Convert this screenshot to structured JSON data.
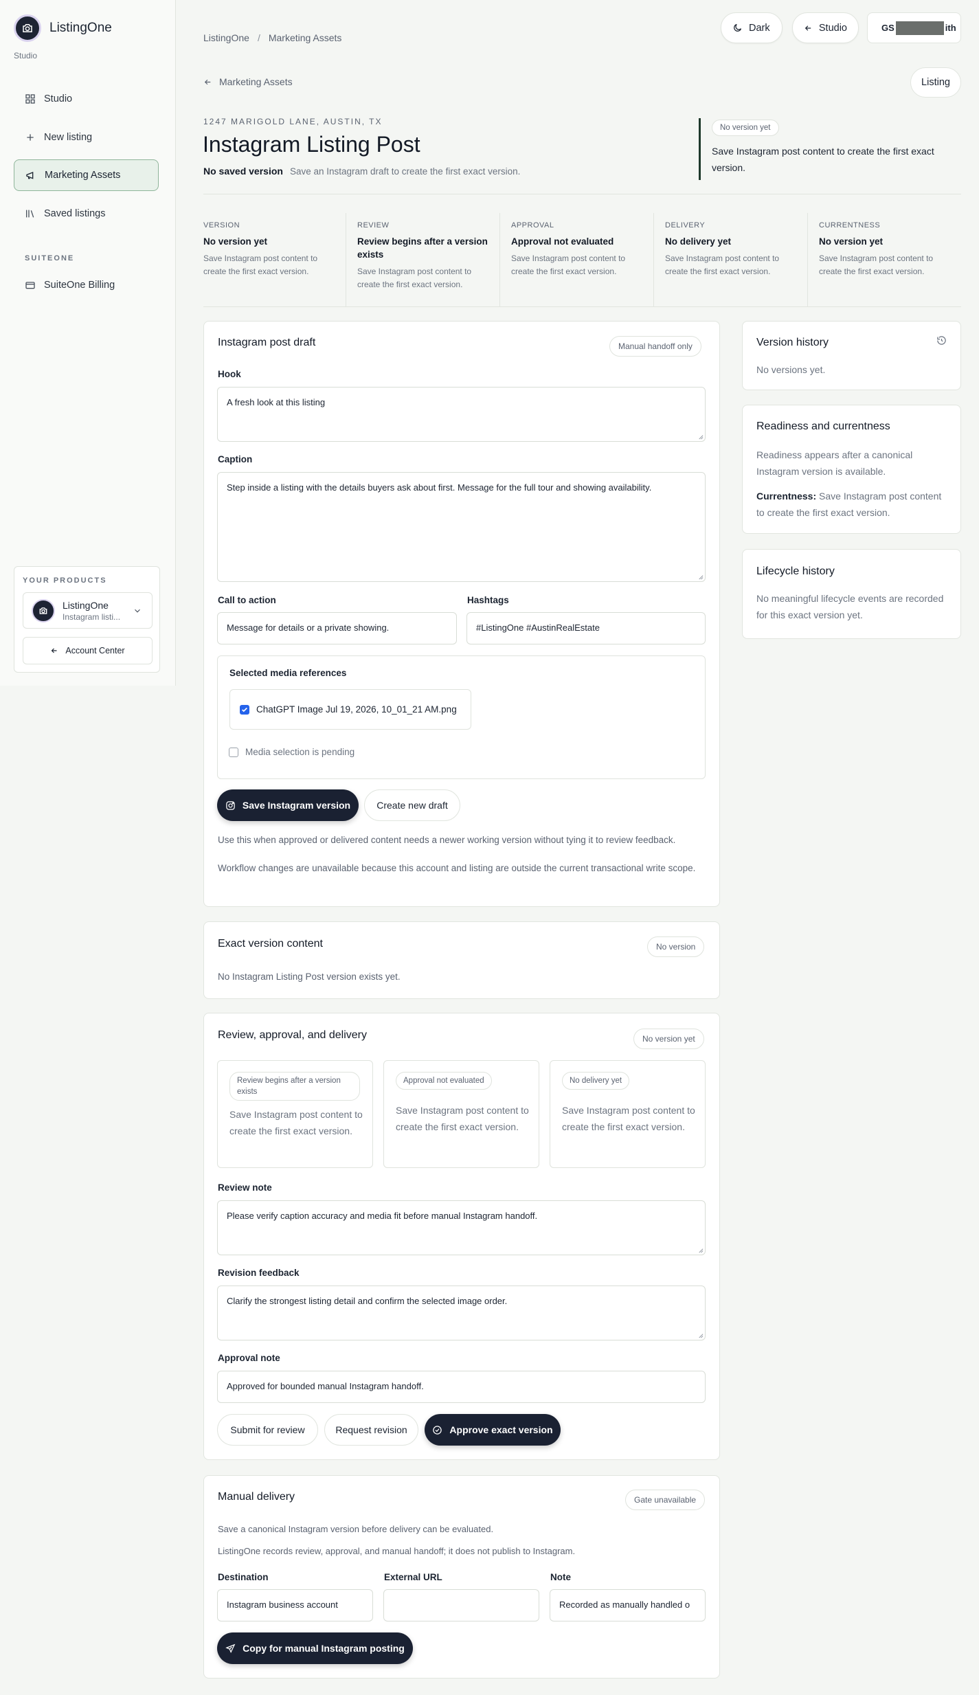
{
  "app": {
    "name": "ListingOne",
    "subtitle": "Studio"
  },
  "sidebar": {
    "items": [
      {
        "label": "Studio",
        "icon": "grid-icon"
      },
      {
        "label": "New listing",
        "icon": "plus-icon"
      },
      {
        "label": "Marketing Assets",
        "icon": "megaphone-icon"
      },
      {
        "label": "Saved listings",
        "icon": "library-icon"
      }
    ],
    "section_label": "SUITEONE",
    "billing_label": "SuiteOne Billing",
    "products": {
      "heading": "YOUR PRODUCTS",
      "selected_name": "ListingOne",
      "selected_desc": "Instagram listi...",
      "account_center": "Account Center"
    }
  },
  "topbar": {
    "breadcrumb": [
      "ListingOne",
      "Marketing Assets"
    ],
    "dark_label": "Dark",
    "studio_label": "Studio",
    "user_prefix": "GS",
    "user_suffix": "ith"
  },
  "header": {
    "back_label": "Marketing Assets",
    "listing_pill": "Listing",
    "address": "1247 MARIGOLD LANE, AUSTIN, TX",
    "title": "Instagram Listing Post",
    "status_bold": "No saved version",
    "status_hint": "Save an Instagram draft to create the first exact version.",
    "callout_tag": "No version yet",
    "callout_text": "Save Instagram post content to create the first exact version."
  },
  "summary": [
    {
      "key": "VERSION",
      "value": "No version yet",
      "desc": "Save Instagram post content to create the first exact version."
    },
    {
      "key": "REVIEW",
      "value": "Review begins after a version exists",
      "desc": "Save Instagram post content to create the first exact version."
    },
    {
      "key": "APPROVAL",
      "value": "Approval not evaluated",
      "desc": "Save Instagram post content to create the first exact version."
    },
    {
      "key": "DELIVERY",
      "value": "No delivery yet",
      "desc": "Save Instagram post content to create the first exact version."
    },
    {
      "key": "CURRENTNESS",
      "value": "No version yet",
      "desc": "Save Instagram post content to create the first exact version."
    }
  ],
  "draft": {
    "title": "Instagram post draft",
    "chip": "Manual handoff only",
    "hook_label": "Hook",
    "hook_value": "A fresh look at this listing",
    "caption_label": "Caption",
    "caption_value": "Step inside a listing with the details buyers ask about first. Message for the full tour and showing availability.",
    "cta_label": "Call to action",
    "cta_value": "Message for details or a private showing.",
    "hashtags_label": "Hashtags",
    "hashtags_value": "#ListingOne #AustinRealEstate",
    "media_heading": "Selected media references",
    "media_item": "ChatGPT Image Jul 19, 2026, 10_01_21 AM.png",
    "media_pending": "Media selection is pending",
    "save_button": "Save Instagram version",
    "new_draft_button": "Create new draft",
    "note_1": "Use this when approved or delivered content needs a newer working version without tying it to review feedback.",
    "note_2": "Workflow changes are unavailable because this account and listing are outside the current transactional write scope."
  },
  "exact": {
    "title": "Exact version content",
    "chip": "No version",
    "text": "No Instagram Listing Post version exists yet."
  },
  "review": {
    "title": "Review, approval, and delivery",
    "chip": "No version yet",
    "cards": [
      {
        "chip": "Review begins after a version exists",
        "text": "Save Instagram post content to create the first exact version."
      },
      {
        "chip": "Approval not evaluated",
        "text": "Save Instagram post content to create the first exact version."
      },
      {
        "chip": "No delivery yet",
        "text": "Save Instagram post content to create the first exact version."
      }
    ],
    "review_note_label": "Review note",
    "review_note_value": "Please verify caption accuracy and media fit before manual Instagram handoff.",
    "revision_label": "Revision feedback",
    "revision_value": "Clarify the strongest listing detail and confirm the selected image order.",
    "approval_label": "Approval note",
    "approval_value": "Approved for bounded manual Instagram handoff.",
    "submit_button": "Submit for review",
    "revision_button": "Request revision",
    "approve_button": "Approve exact version"
  },
  "delivery": {
    "title": "Manual delivery",
    "chip": "Gate unavailable",
    "text_1": "Save a canonical Instagram version before delivery can be evaluated.",
    "text_2": "ListingOne records review, approval, and manual handoff; it does not publish to Instagram.",
    "destination_label": "Destination",
    "destination_value": "Instagram business account",
    "url_label": "External URL",
    "url_value": "",
    "note_label": "Note",
    "note_value": "Recorded as manually handled o",
    "copy_button": "Copy for manual Instagram posting"
  },
  "right": {
    "history_title": "Version history",
    "history_text": "No versions yet.",
    "ready_title": "Readiness and currentness",
    "ready_text": "Readiness appears after a canonical Instagram version is available.",
    "currentness_label": "Currentness:",
    "currentness_text": "Save Instagram post content to create the first exact version.",
    "lifecycle_title": "Lifecycle history",
    "lifecycle_text": "No meaningful lifecycle events are recorded for this exact version yet."
  },
  "colors": {
    "accent_dark": "#1a2132",
    "nav_active_bg": "#e8f1ea",
    "nav_active_border": "#8fb59a",
    "checkbox": "#2563eb"
  }
}
